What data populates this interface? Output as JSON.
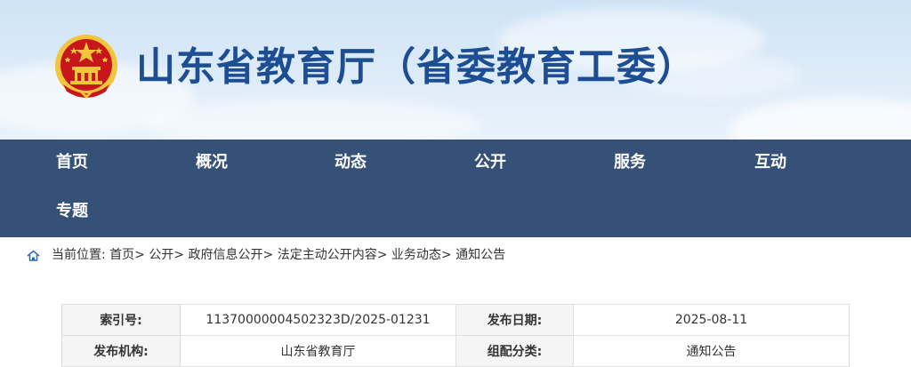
{
  "header": {
    "title": "山东省教育厅（省委教育工委）",
    "emblem": "national-emblem"
  },
  "nav": {
    "items": [
      {
        "label": "首页"
      },
      {
        "label": "概况"
      },
      {
        "label": "动态"
      },
      {
        "label": "公开"
      },
      {
        "label": "服务"
      },
      {
        "label": "互动"
      },
      {
        "label": "专题"
      }
    ]
  },
  "breadcrumb": {
    "icon": "home-icon",
    "prefix": "当前位置:",
    "items": [
      "首页",
      "公开",
      "政府信息公开",
      "法定主动公开内容",
      "业务动态",
      "通知公告"
    ],
    "separator": ">"
  },
  "meta": {
    "rows": [
      {
        "label1": "索引号:",
        "value1": "11370000004502323D/2025-01231",
        "label2": "发布日期:",
        "value2": "2025-08-11"
      },
      {
        "label1": "发布机构:",
        "value1": "山东省教育厅",
        "label2": "组配分类:",
        "value2": "通知公告"
      }
    ]
  },
  "colors": {
    "nav_bg": "#355178",
    "title_blue": "#1d4e93",
    "emblem_red": "#c8161d",
    "emblem_gold": "#f2c53d"
  }
}
